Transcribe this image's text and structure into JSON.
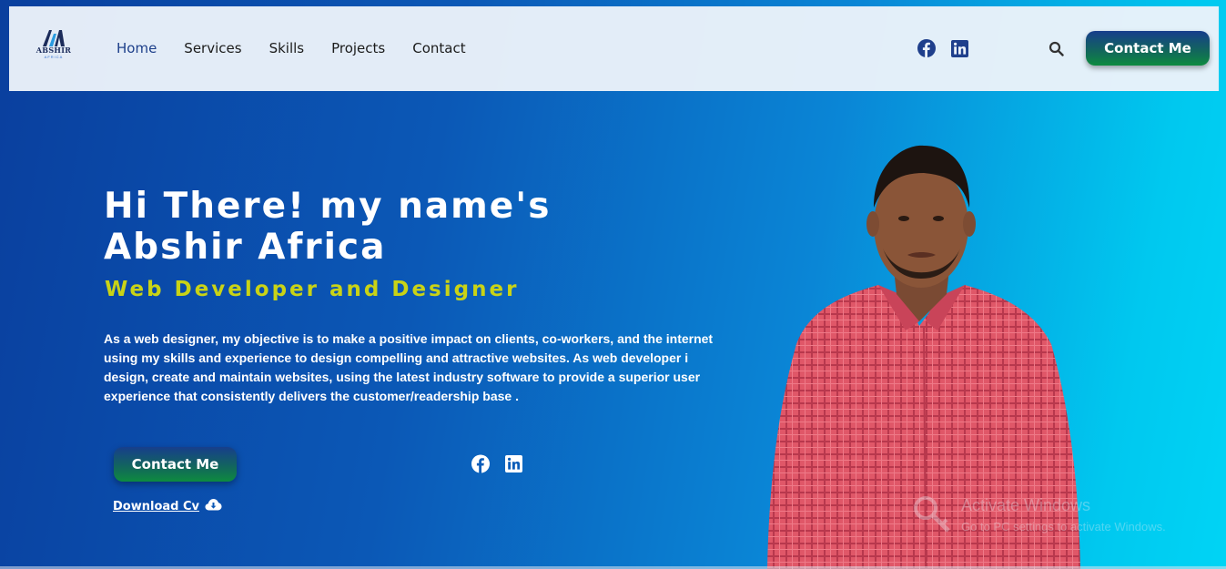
{
  "logo": {
    "brand": "ABSHIR",
    "sub": "AFRICA"
  },
  "nav": {
    "links": [
      "Home",
      "Services",
      "Skills",
      "Projects",
      "Contact"
    ],
    "cta_label": "Contact Me"
  },
  "hero": {
    "title_line1": "Hi There! my name's",
    "title_line2": "Abshir Africa",
    "subtitle": "Web Developer and Designer",
    "description": "As a web designer, my objective is to make a positive impact on clients, co-workers, and the internet using my skills and experience to design compelling and attractive websites. As web developer i design, create and maintain websites, using the latest industry software to provide a superior user experience that consistently delivers the customer/readership base .",
    "cta_label": "Contact Me",
    "download_label": "Download Cv"
  },
  "watermark": {
    "title": "Activate Windows",
    "message": "Go to PC settings to activate Windows."
  },
  "icons": {
    "social": [
      "facebook-icon",
      "linkedin-icon"
    ],
    "search": "search-icon",
    "download": "cloud-download-icon"
  },
  "colors": {
    "accent_yellow": "#c9d316",
    "nav_active": "#1d3f8a",
    "button_top": "#173e8c",
    "button_bottom": "#0e8b3f"
  }
}
